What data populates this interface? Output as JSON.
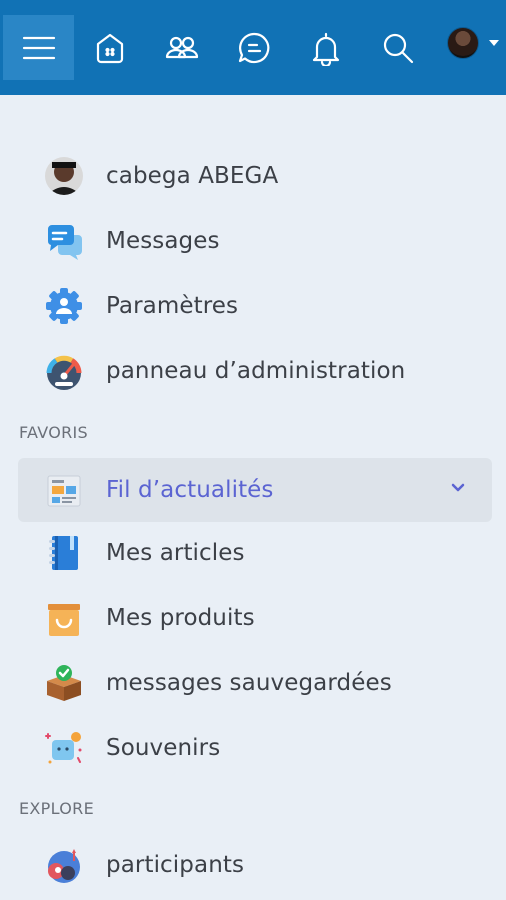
{
  "topbar": {
    "icons": [
      "menu-icon",
      "home-icon",
      "friends-icon",
      "chat-icon",
      "bell-icon",
      "search-icon"
    ],
    "avatar": "profile-avatar"
  },
  "profile": {
    "name": "cabega ABEGA"
  },
  "menu": [
    {
      "label": "Messages",
      "icon": "messages-icon"
    },
    {
      "label": "Paramètres",
      "icon": "settings-icon"
    },
    {
      "label": "panneau d’administration",
      "icon": "dashboard-gauge-icon"
    }
  ],
  "favoris": {
    "title": "FAVORIS",
    "items": [
      {
        "label": "Fil d’actualités",
        "icon": "newsfeed-icon",
        "active": true
      },
      {
        "label": "Mes articles",
        "icon": "notebook-icon"
      },
      {
        "label": "Mes produits",
        "icon": "shopping-bag-icon"
      },
      {
        "label": "messages sauvegardées",
        "icon": "saved-box-icon"
      },
      {
        "label": "Souvenirs",
        "icon": "memories-icon"
      }
    ]
  },
  "explore": {
    "title": "EXPLORE",
    "items": [
      {
        "label": "participants",
        "icon": "participants-icon"
      }
    ]
  },
  "colors": {
    "topbar": "#1172b5",
    "background": "#e9eff6",
    "active_text": "#5b64d2"
  }
}
